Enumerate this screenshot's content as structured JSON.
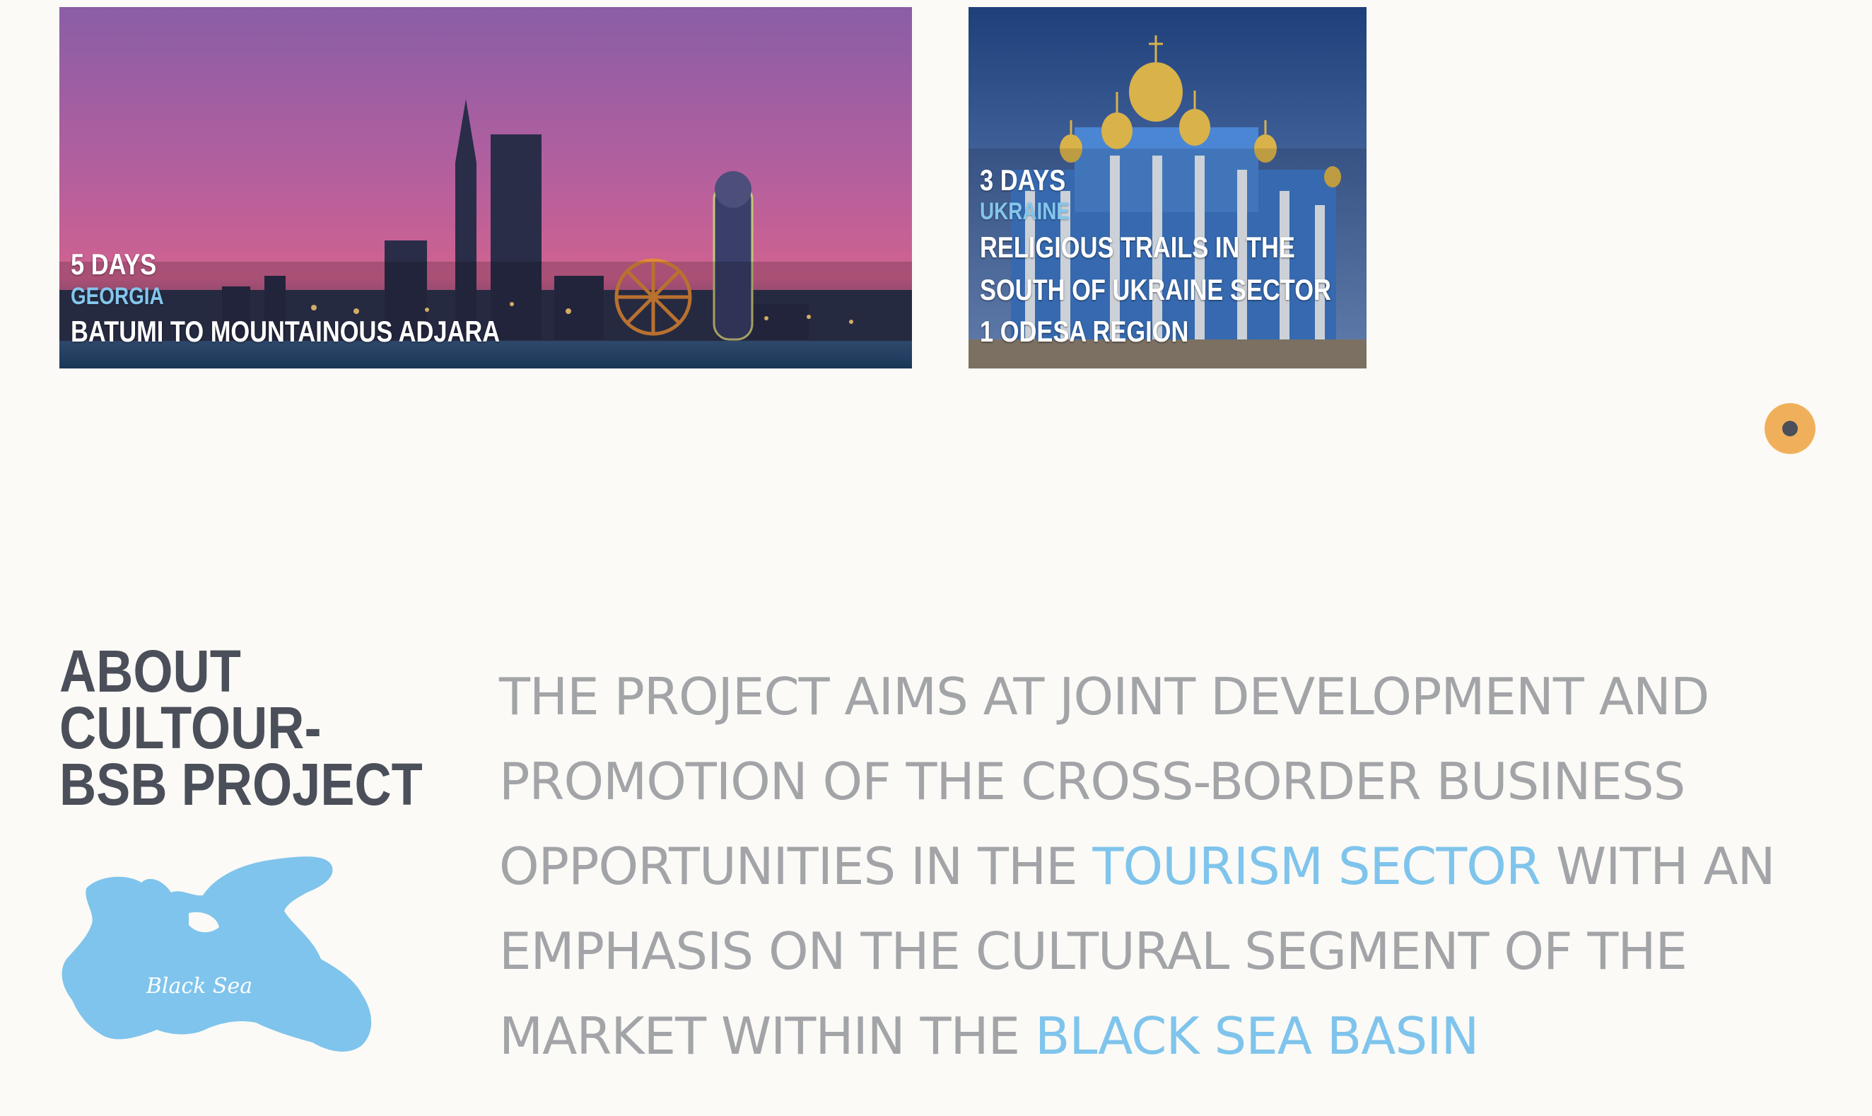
{
  "tours": [
    {
      "days": "5 DAYS",
      "country": "GEORGIA",
      "title": "BATUMI TO MOUNTAINOUS ADJARA"
    },
    {
      "days": "3 DAYS",
      "country": "UKRAINE",
      "title": "RELIGIOUS TRAILS IN THE SOUTH OF UKRAINE SECTOR 1 ODESA REGION"
    }
  ],
  "about": {
    "heading": "ABOUT CULTOUR-BSB PROJECT",
    "map_label": "Black Sea",
    "statement": {
      "part1": "THE PROJECT AIMS AT JOINT DEVELOPMENT AND PROMOTION OF THE CROSS-BORDER BUSINESS OPPORTUNITIES IN THE ",
      "highlight1": "TOURISM SECTOR",
      "part2": " WITH AN EMPHASIS ON THE CULTURAL SEGMENT OF THE MARKET WITHIN THE ",
      "highlight2": "BLACK SEA BASIN"
    }
  },
  "colors": {
    "background": "#fbfaf6",
    "accent_blue": "#7fc4ec",
    "heading_dark": "#4b4f5a",
    "body_gray": "#a3a4a8",
    "scroll_button": "#f0b05b"
  },
  "icons": {
    "scroll_button": "circle-dot-icon"
  }
}
